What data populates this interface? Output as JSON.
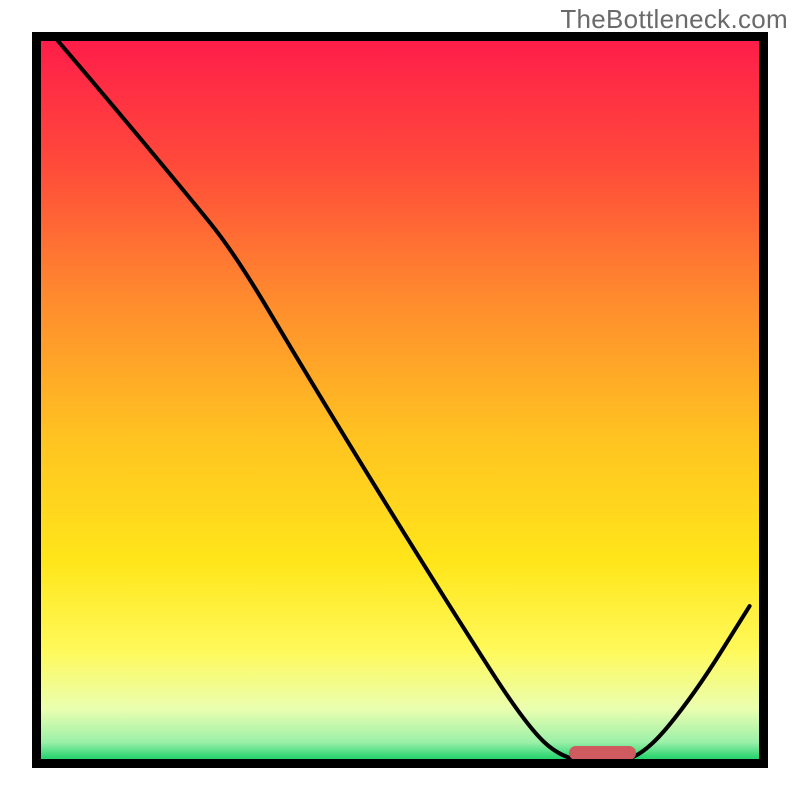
{
  "watermark": "TheBottleneck.com",
  "chart_data": {
    "type": "line",
    "title": "",
    "xlabel": "",
    "ylabel": "",
    "xlim": [
      0,
      100
    ],
    "ylim": [
      0,
      100
    ],
    "grid": false,
    "legend": false,
    "gradient_stops": [
      {
        "offset": 0.0,
        "color": "#ff1a4b"
      },
      {
        "offset": 0.18,
        "color": "#ff4a3a"
      },
      {
        "offset": 0.36,
        "color": "#ff8a2e"
      },
      {
        "offset": 0.55,
        "color": "#ffc321"
      },
      {
        "offset": 0.72,
        "color": "#ffe61a"
      },
      {
        "offset": 0.84,
        "color": "#fff95a"
      },
      {
        "offset": 0.92,
        "color": "#eaffb0"
      },
      {
        "offset": 0.965,
        "color": "#9bf0a8"
      },
      {
        "offset": 0.985,
        "color": "#2fd673"
      },
      {
        "offset": 1.0,
        "color": "#15c860"
      }
    ],
    "series": [
      {
        "name": "bottleneck-curve",
        "points": [
          {
            "x": 2.5,
            "y": 100.0
          },
          {
            "x": 11.0,
            "y": 90.0
          },
          {
            "x": 21.0,
            "y": 78.0
          },
          {
            "x": 27.5,
            "y": 70.0
          },
          {
            "x": 37.0,
            "y": 54.0
          },
          {
            "x": 48.0,
            "y": 36.0
          },
          {
            "x": 58.0,
            "y": 20.0
          },
          {
            "x": 67.0,
            "y": 6.0
          },
          {
            "x": 72.0,
            "y": 1.2
          },
          {
            "x": 78.0,
            "y": 0.8
          },
          {
            "x": 83.0,
            "y": 1.5
          },
          {
            "x": 90.0,
            "y": 10.0
          },
          {
            "x": 97.5,
            "y": 22.0
          }
        ]
      }
    ],
    "marker": {
      "name": "optimal-range",
      "x_start": 73.0,
      "x_end": 82.0,
      "y": 0.8,
      "color": "#cf5b61"
    }
  }
}
